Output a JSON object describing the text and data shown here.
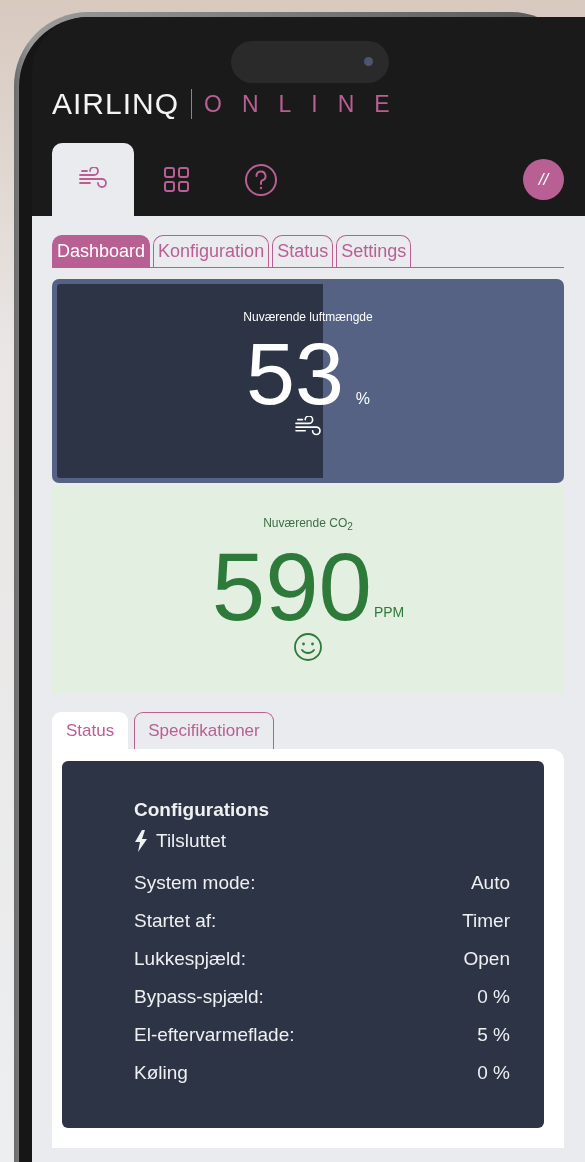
{
  "logo": {
    "brand": "AIRLINQ",
    "product": "ONLINE"
  },
  "nav_tabs": [
    {
      "kind": "wind",
      "selected": true
    },
    {
      "kind": "grid",
      "selected": false
    },
    {
      "kind": "help",
      "selected": false
    }
  ],
  "avatar": {
    "text": "//"
  },
  "tabs": [
    {
      "label": "Dashboard",
      "selected": true
    },
    {
      "label": "Konfiguration",
      "selected": false
    },
    {
      "label": "Status",
      "selected": false
    },
    {
      "label": "Settings",
      "selected": false
    }
  ],
  "airflow": {
    "label": "Nuværende luftmængde",
    "value": "53",
    "unit": "%",
    "level": 0.53
  },
  "co2": {
    "label": "Nuværende CO$_{2}$",
    "value": "590",
    "unit": "PPM"
  },
  "detail_tabs": [
    {
      "label": "Status",
      "selected": true
    },
    {
      "label": "Specifikationer",
      "selected": false
    }
  ],
  "status_panel": {
    "title": "Configurations",
    "connection": "Tilsluttet",
    "rows": [
      {
        "label": "System mode:",
        "value": "Auto"
      },
      {
        "label": "Startet af:",
        "value": "Timer"
      },
      {
        "label": "Lukkespjæld:",
        "value": "Open"
      },
      {
        "label": "Bypass-spjæld:",
        "value": "0 %"
      },
      {
        "label": "El-eftervarmeflade:",
        "value": "5 %"
      },
      {
        "label": "Køling",
        "value": "0 %"
      }
    ]
  }
}
